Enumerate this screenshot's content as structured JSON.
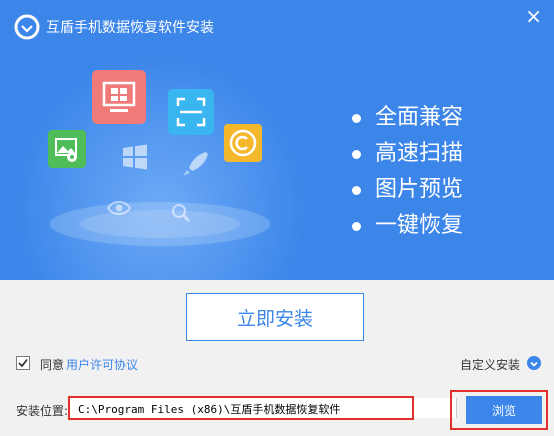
{
  "window": {
    "title": "互盾手机数据恢复软件安装",
    "close_glyph": "×"
  },
  "features": [
    {
      "label": "全面兼容"
    },
    {
      "label": "高速扫描"
    },
    {
      "label": "图片预览"
    },
    {
      "label": "一键恢复"
    }
  ],
  "install_button": "立即安装",
  "agreement": {
    "checked": true,
    "prefix": "同意",
    "link": "用户许可协议"
  },
  "custom_install": {
    "label": "自定义安装"
  },
  "install_path": {
    "label": "安装位置:",
    "value": "C:\\Program Files (x86)\\互盾手机数据恢复软件"
  },
  "browse_button": "浏览",
  "colors": {
    "brand_blue": "#3c86ea",
    "highlight_red": "#e0302a"
  },
  "icons": [
    "app-logo-icon",
    "monitor-windows-icon",
    "scan-frame-icon",
    "copyright-icon",
    "photo-eye-icon",
    "windows-icon",
    "rocket-icon",
    "eye-icon",
    "magnifier-icon"
  ]
}
